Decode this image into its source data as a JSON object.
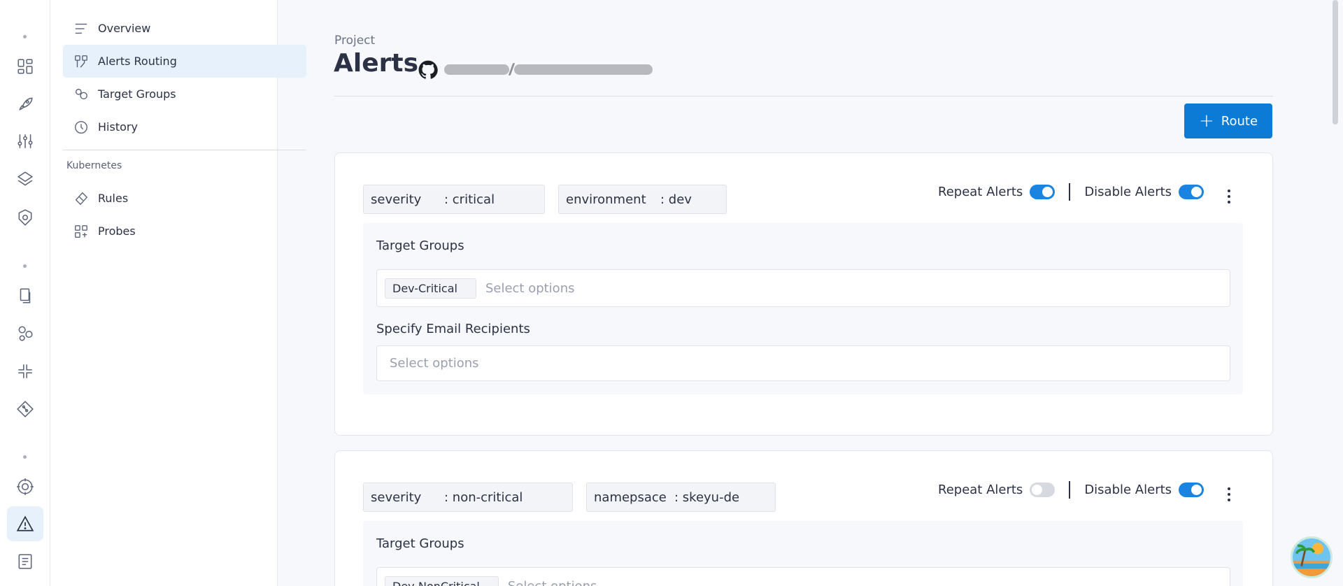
{
  "nav": {
    "items": [
      {
        "label": "Overview",
        "icon": "list-icon"
      },
      {
        "label": "Alerts Routing",
        "icon": "routing-icon"
      },
      {
        "label": "Target Groups",
        "icon": "groups-icon"
      },
      {
        "label": "History",
        "icon": "history-icon"
      }
    ],
    "section": "Kubernetes",
    "k8s_items": [
      {
        "label": "Rules",
        "icon": "rules-icon"
      },
      {
        "label": "Probes",
        "icon": "probes-icon"
      }
    ]
  },
  "header": {
    "breadcrumb": "Project",
    "title": "Alerts",
    "route_button": "Route"
  },
  "routes": [
    {
      "tags": [
        {
          "key": "severity",
          "value": ": critical"
        },
        {
          "key": "environment",
          "value": ": dev"
        }
      ],
      "repeat_label": "Repeat Alerts",
      "repeat_on": true,
      "disable_label": "Disable Alerts",
      "disable_on": true,
      "target_groups_label": "Target Groups",
      "target_group_chip": "Dev-Critical",
      "target_placeholder": "Select options",
      "email_label": "Specify Email Recipients",
      "email_placeholder": "Select options"
    },
    {
      "tags": [
        {
          "key": "severity",
          "value": ": non-critical"
        },
        {
          "key": "namepsace",
          "value": ": skeyu-de"
        }
      ],
      "repeat_label": "Repeat Alerts",
      "repeat_on": false,
      "disable_label": "Disable Alerts",
      "disable_on": true,
      "target_groups_label": "Target Groups",
      "target_group_chip": "Dev-NonCritical",
      "target_placeholder": "Select options"
    }
  ],
  "colors": {
    "accent": "#0b7bd6",
    "toggle_on": "#1a84e0",
    "toggle_off": "#d6d9df"
  }
}
